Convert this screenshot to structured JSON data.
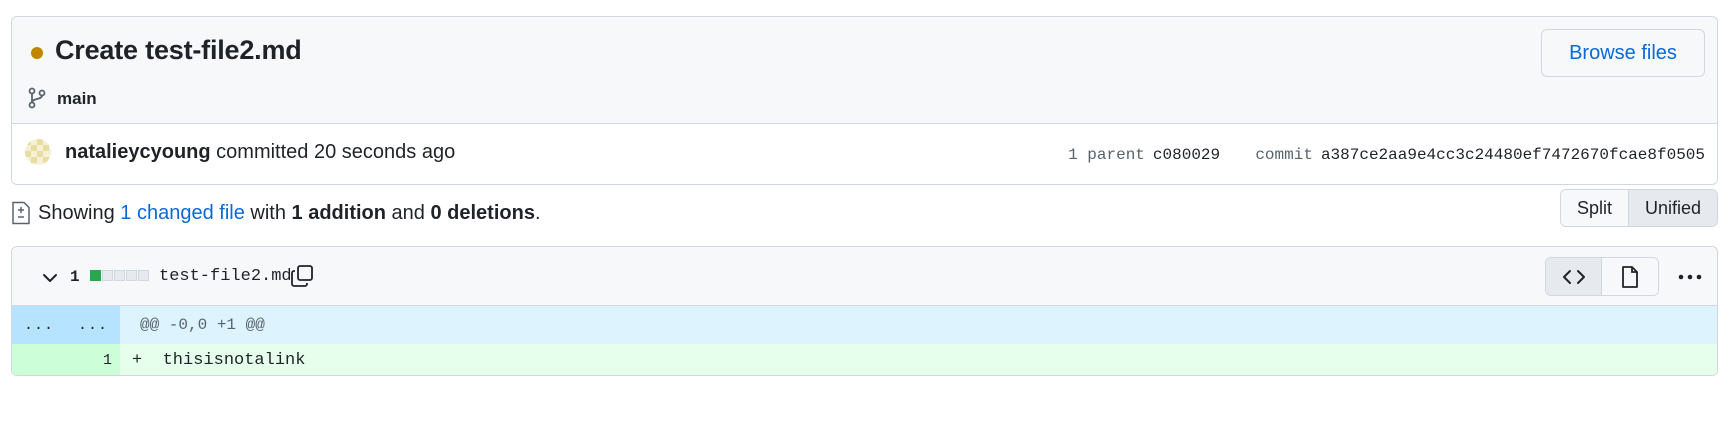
{
  "commit": {
    "title": "Create test-file2.md",
    "branch": "main",
    "browse_label": "Browse files",
    "author": "natalieycyoung",
    "action": "committed",
    "time_ago": "20 seconds ago",
    "parent_label": "1 parent",
    "parent_sha": "c080029",
    "commit_label": "commit",
    "commit_sha": "a387ce2aa9e4cc3c24480ef7472670fcae8f0505",
    "status_color": "#bf8700"
  },
  "summary": {
    "prefix": "Showing",
    "changed": "1 changed file",
    "with": "with",
    "additions": "1 addition",
    "and": "and",
    "deletions": "0 deletions",
    "end": "."
  },
  "view_toggle": {
    "split": "Split",
    "unified": "Unified",
    "selected": "Unified"
  },
  "file": {
    "change_count": "1",
    "filename": "test-file2.md",
    "hunk_old_num": "...",
    "hunk_new_num": "...",
    "hunk_header": "@@ -0,0 +1 @@",
    "lines": [
      {
        "new_num": "1",
        "marker": "+",
        "text": "thisisnotalink"
      }
    ]
  },
  "icons": {
    "status": "status-dot",
    "branch": "git-branch-icon",
    "diff": "file-diff-icon",
    "chevron": "chevron-down-icon",
    "copy": "copy-icon",
    "code": "code-icon",
    "file": "file-icon",
    "more": "kebab-horizontal-icon"
  }
}
